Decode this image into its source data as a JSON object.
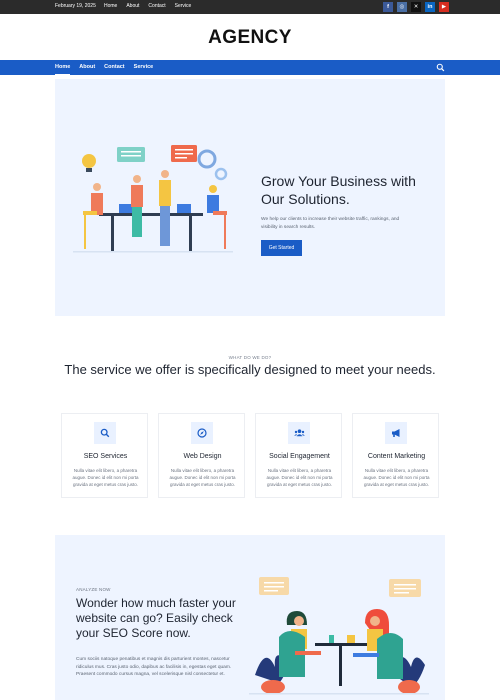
{
  "topbar": {
    "date": "February 19, 2025",
    "links": [
      "Home",
      "About",
      "Contact",
      "Service"
    ],
    "socials": [
      {
        "name": "facebook-icon",
        "glyph": "f",
        "color": "#3b5998"
      },
      {
        "name": "instagram-icon",
        "glyph": "◎",
        "color": "#4a6fa5"
      },
      {
        "name": "x-icon",
        "glyph": "✕",
        "color": "#111111"
      },
      {
        "name": "linkedin-icon",
        "glyph": "in",
        "color": "#0a66c2"
      },
      {
        "name": "youtube-icon",
        "glyph": "▶",
        "color": "#d62d20"
      }
    ]
  },
  "header": {
    "brand": "AGENCY"
  },
  "nav": {
    "links": [
      "Home",
      "About",
      "Contact",
      "Service"
    ],
    "active": "Home",
    "search_icon": "search-icon"
  },
  "hero": {
    "title": "Grow Your Business with Our Solutions.",
    "text": "We help our clients to increase their website traffic, rankings, and visibility in search results.",
    "button": "Get Started"
  },
  "services": {
    "eyebrow": "WHAT DO WE DO?",
    "title": "The service we offer is specifically designed to meet your needs.",
    "cards": [
      {
        "title": "SEO Services",
        "icon": "search-icon",
        "text": "Nulla vitae elit libero, a pharetra augue. Donec id elit non mi porta gravida at eget metus cras justo."
      },
      {
        "title": "Web Design",
        "icon": "compass-icon",
        "text": "Nulla vitae elit libero, a pharetra augue. Donec id elit non mi porta gravida at eget metus cras justo."
      },
      {
        "title": "Social Engagement",
        "icon": "users-icon",
        "text": "Nulla vitae elit libero, a pharetra augue. Donec id elit non mi porta gravida at eget metus cras justo."
      },
      {
        "title": "Content Marketing",
        "icon": "megaphone-icon",
        "text": "Nulla vitae elit libero, a pharetra augue. Donec id elit non mi porta gravida at eget metus cras justo."
      }
    ]
  },
  "seo": {
    "eyebrow": "ANALYZE NOW",
    "title": "Wonder how much faster your website can go? Easily check your SEO Score now.",
    "text": "Cum sociis natoque penatibus et magnis dis parturient montes, nascetur ridiculus mus. Cras justo odio, dapibus ac facilisis in, egestas eget quam. Praesent commodo cursus magna, vel scelerisque nisl consectetur et."
  },
  "colors": {
    "brand": "#1a5cc6",
    "hero_bg": "#eef4ff",
    "topbar": "#2b2b2b"
  }
}
